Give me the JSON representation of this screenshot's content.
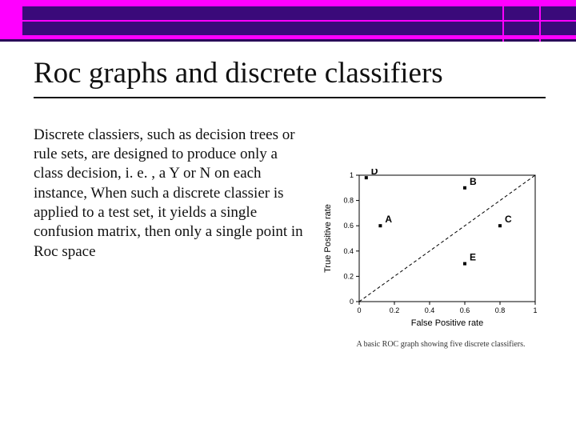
{
  "title": "Roc graphs and discrete classifiers",
  "body": "Discrete classiers, such as decision trees or rule sets, are designed to produce only a class decision, i. e. , a Y or N on each instance, When such a discrete classier is applied to a test set, it yields a single confusion matrix, then only a single point in Roc space",
  "chart_data": {
    "type": "scatter",
    "title": "",
    "xlabel": "False Positive rate",
    "ylabel": "True Positive rate",
    "xlim": [
      0,
      1.0
    ],
    "ylim": [
      0,
      1.0
    ],
    "xticks": [
      0,
      0.2,
      0.4,
      0.6,
      0.8,
      1.0
    ],
    "yticks": [
      0,
      0.2,
      0.4,
      0.6,
      0.8,
      1.0
    ],
    "series": [
      {
        "name": "A",
        "x": 0.12,
        "y": 0.6
      },
      {
        "name": "B",
        "x": 0.6,
        "y": 0.9
      },
      {
        "name": "C",
        "x": 0.8,
        "y": 0.6
      },
      {
        "name": "D",
        "x": 0.04,
        "y": 0.98
      },
      {
        "name": "E",
        "x": 0.6,
        "y": 0.3
      }
    ],
    "diagonal": {
      "x1": 0,
      "y1": 0,
      "x2": 1.0,
      "y2": 1.0
    }
  },
  "caption": "A basic ROC graph showing five discrete classifiers."
}
